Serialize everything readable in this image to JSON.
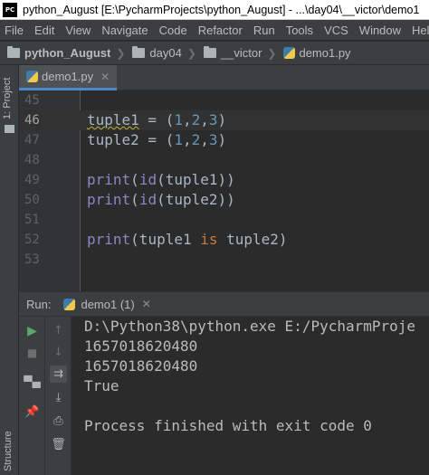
{
  "window": {
    "title": "python_August [E:\\PycharmProjects\\python_August] - ...\\day04\\__victor\\demo1",
    "logo": "PC"
  },
  "menu": [
    "File",
    "Edit",
    "View",
    "Navigate",
    "Code",
    "Refactor",
    "Run",
    "Tools",
    "VCS",
    "Window",
    "Help"
  ],
  "breadcrumb": {
    "project": "python_August",
    "folder1": "day04",
    "folder2": "__victor",
    "file": "demo1.py"
  },
  "sidebar": {
    "project_tab": "1: Project",
    "structure_tab": "Structure"
  },
  "editor": {
    "tab_label": "demo1.py",
    "lines": [
      {
        "num": "45",
        "text": ""
      },
      {
        "num": "46",
        "text": "tuple1 = (1,2,3)"
      },
      {
        "num": "47",
        "text": "tuple2 = (1,2,3)"
      },
      {
        "num": "48",
        "text": ""
      },
      {
        "num": "49",
        "text": "print(id(tuple1))"
      },
      {
        "num": "50",
        "text": "print(id(tuple2))"
      },
      {
        "num": "51",
        "text": ""
      },
      {
        "num": "52",
        "text": "print(tuple1 is tuple2)"
      },
      {
        "num": "53",
        "text": ""
      }
    ],
    "current_line": "46"
  },
  "run_panel": {
    "label": "Run:",
    "tab_label": "demo1 (1)",
    "output": [
      "D:\\Python38\\python.exe E:/PycharmProje",
      "1657018620480",
      "1657018620480",
      "True",
      "",
      "Process finished with exit code 0"
    ]
  },
  "colors": {
    "keyword": "#cc7832",
    "number": "#6897bb",
    "builtin": "#8888c6",
    "text": "#a9b7c6",
    "accent": "#4a88c7"
  }
}
